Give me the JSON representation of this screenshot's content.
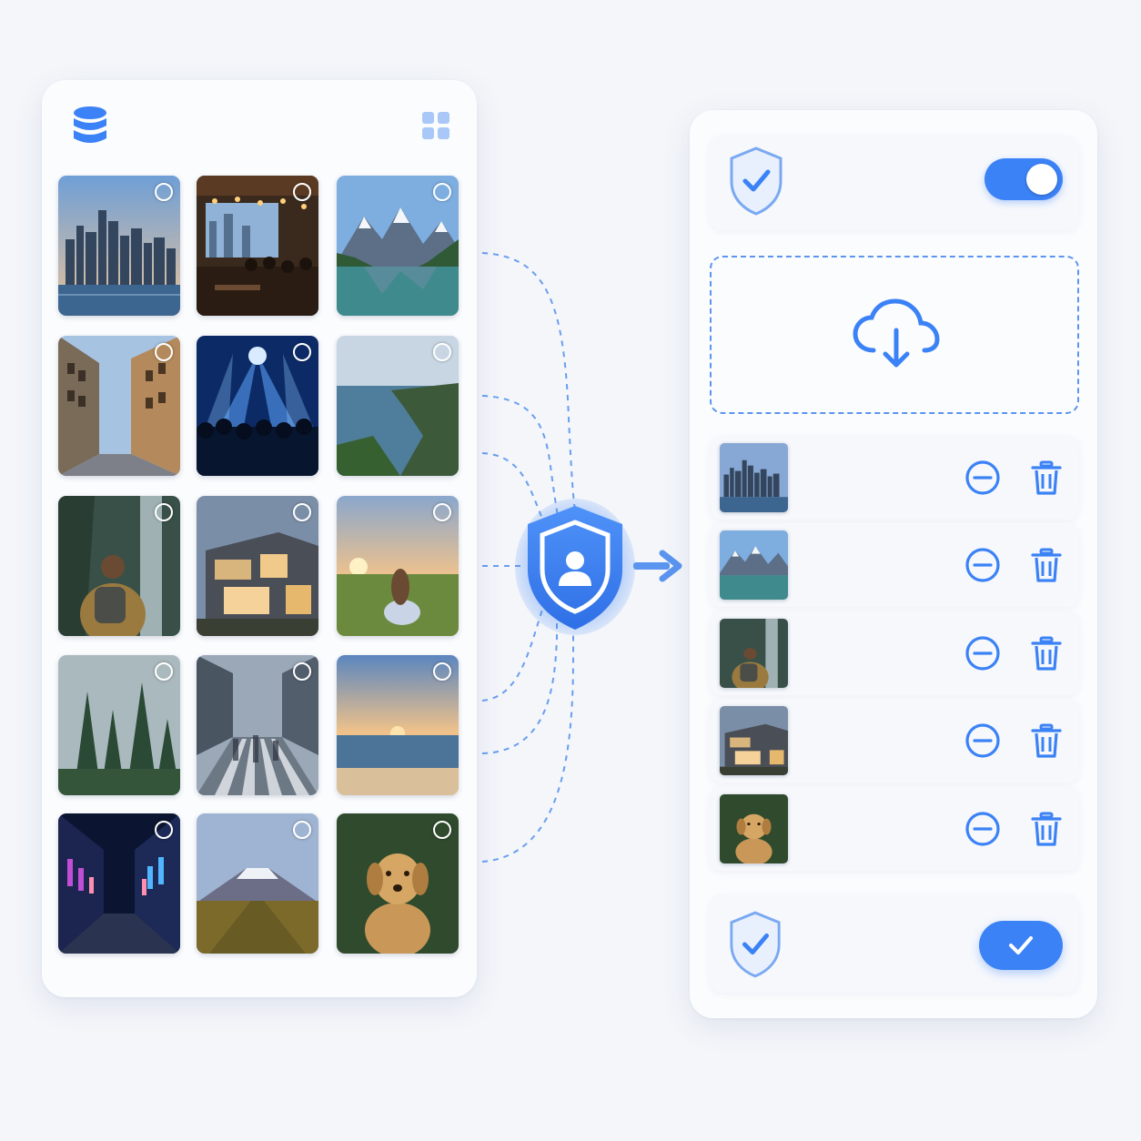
{
  "colors": {
    "accent": "#3b82f6",
    "accent_light": "#93bbf6",
    "panel_bg": "#fbfcfe",
    "page_bg": "#f4f6fa",
    "connector": "#5b95ef"
  },
  "gallery": {
    "header_left_icon": "database-icon",
    "header_right_icon": "grid-view-icon",
    "thumbnails": [
      {
        "scene": "city-skyline",
        "selected": false
      },
      {
        "scene": "restaurant-interior",
        "selected": false
      },
      {
        "scene": "mountain-lake",
        "selected": false
      },
      {
        "scene": "old-town-street",
        "selected": false
      },
      {
        "scene": "concert-crowd",
        "selected": false
      },
      {
        "scene": "sea-cliffs",
        "selected": false
      },
      {
        "scene": "hiker-waterfall",
        "selected": false
      },
      {
        "scene": "modern-house",
        "selected": false
      },
      {
        "scene": "woman-in-meadow",
        "selected": false
      },
      {
        "scene": "misty-forest",
        "selected": false
      },
      {
        "scene": "busy-crosswalk",
        "selected": false
      },
      {
        "scene": "beach-sunset",
        "selected": false
      },
      {
        "scene": "neon-street-night",
        "selected": false
      },
      {
        "scene": "volcano-mountain",
        "selected": false
      },
      {
        "scene": "golden-retriever",
        "selected": false
      }
    ]
  },
  "hub": {
    "icon": "shield-user-icon",
    "arrow_icon": "arrow-right-icon"
  },
  "side_panel": {
    "security": {
      "icon": "shield-check-icon",
      "toggle_on": true
    },
    "dropzone": {
      "icon": "cloud-download-icon"
    },
    "queue": [
      {
        "scene": "city-skyline",
        "actions": [
          "remove-icon",
          "trash-icon"
        ]
      },
      {
        "scene": "mountain-lake",
        "actions": [
          "remove-icon",
          "trash-icon"
        ]
      },
      {
        "scene": "hiker-waterfall",
        "actions": [
          "remove-icon",
          "trash-icon"
        ]
      },
      {
        "scene": "modern-house",
        "actions": [
          "remove-icon",
          "trash-icon"
        ]
      },
      {
        "scene": "golden-retriever",
        "actions": [
          "remove-icon",
          "trash-icon"
        ]
      }
    ],
    "confirm": {
      "icon": "shield-check-icon",
      "button_icon": "checkmark-icon"
    }
  }
}
